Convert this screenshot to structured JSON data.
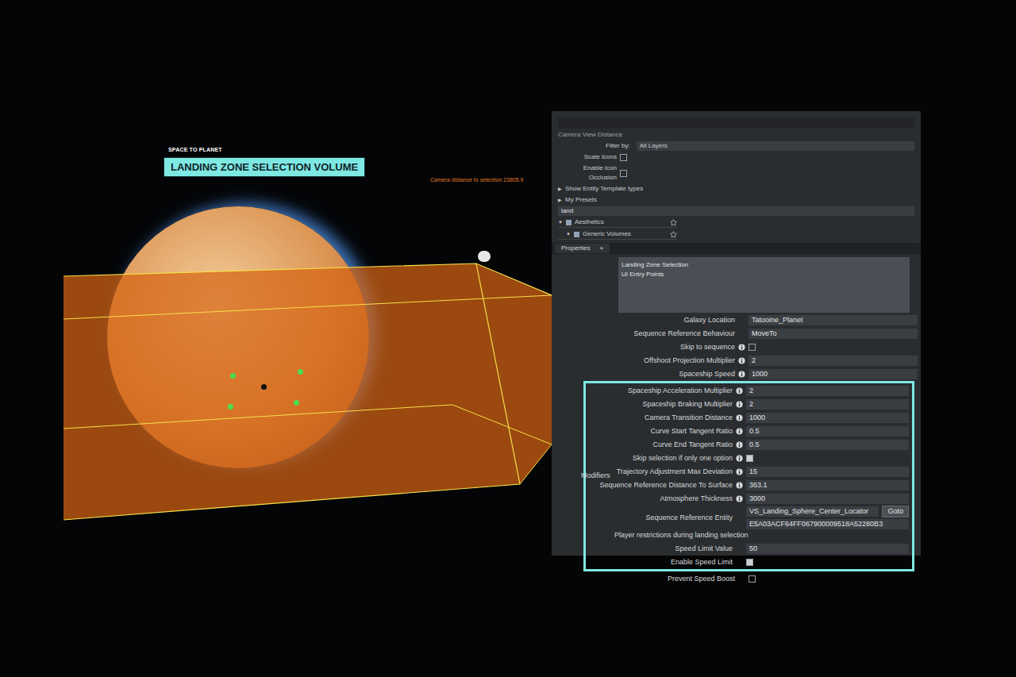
{
  "slide": {
    "section": "SPACE TO PLANET",
    "title": "LANDING ZONE SELECTION VOLUME"
  },
  "viewport": {
    "debug_lines": [
      "Camera distance to selection 23805.9"
    ],
    "markers": [
      {
        "color": "#4ade50"
      },
      {
        "color": "#4ade50"
      },
      {
        "color": "#111111"
      },
      {
        "color": "#4ade50"
      },
      {
        "color": "#4ade50"
      }
    ]
  },
  "outliner": {
    "title": "Camera View Distance",
    "filter_label": "Filter by:",
    "filter_value": "All Layers",
    "options": [
      {
        "label": "Scale Icons",
        "checked": false
      },
      {
        "label": "Enable Icon Occlusion",
        "checked": false
      }
    ],
    "expanders": [
      "Show Entity Template types",
      "My Presets"
    ],
    "search": "land",
    "tree": [
      {
        "label": "Aesthetics",
        "level": 1
      },
      {
        "label": "Generic Volumes",
        "level": 2
      }
    ]
  },
  "properties": {
    "tab": "Properties",
    "close": "×",
    "components": [
      "Landing Zone Selection",
      "UI Entry Points"
    ],
    "rows": [
      {
        "label": "Galaxy Location",
        "kind": "field",
        "value": "Tatooine_Planet",
        "info": false
      },
      {
        "label": "Sequence Reference Behaviour",
        "kind": "field",
        "value": "MoveTo",
        "info": false
      },
      {
        "label": "Skip to sequence",
        "kind": "checkbox",
        "checked": false,
        "info": true
      },
      {
        "label": "Offshoot Projection Multiplier",
        "kind": "field",
        "value": "2",
        "info": true
      },
      {
        "label": "Spaceship Speed",
        "kind": "field",
        "value": "1000",
        "info": true
      }
    ],
    "modifiers_label": "Modifiers",
    "modifier_rows": [
      {
        "label": "Spaceship Acceleration Multiplier",
        "kind": "field",
        "value": "2",
        "info": true
      },
      {
        "label": "Spaceship Braking Multiplier",
        "kind": "field",
        "value": "2",
        "info": true
      },
      {
        "label": "Camera Transition Distance",
        "kind": "field",
        "value": "1000",
        "info": true
      },
      {
        "label": "Curve Start Tangent Ratio",
        "kind": "field",
        "value": "0.5",
        "info": true
      },
      {
        "label": "Curve End Tangent Ratio",
        "kind": "field",
        "value": "0.5",
        "info": true
      },
      {
        "label": "Skip selection if only one option",
        "kind": "checkbox",
        "checked": true,
        "info": true
      },
      {
        "label": "Trajectory Adjustment Max Deviation",
        "kind": "field",
        "value": "15",
        "info": true
      },
      {
        "label": "Sequence Reference Distance To Surface",
        "kind": "field",
        "value": "363.1",
        "info": true
      },
      {
        "label": "Atmosphere Thickness",
        "kind": "field",
        "value": "3000",
        "info": true
      },
      {
        "label": "Sequence Reference Entity",
        "kind": "entity",
        "value": "VS_Landing_Sphere_Center_Locator",
        "button": "Goto",
        "id": "E5A03ACF64FF067900009518A52280B3",
        "info": false
      },
      {
        "label": "Player restrictions during landing selection",
        "kind": "header",
        "info": false
      },
      {
        "label": "Speed Limit Value",
        "kind": "field",
        "value": "50",
        "info": false
      },
      {
        "label": "Enable Speed Limit",
        "kind": "checkbox",
        "checked": true,
        "info": false
      }
    ],
    "after_rows": [
      {
        "label": "Prevent Speed Boost",
        "kind": "checkbox",
        "checked": false,
        "info": false
      }
    ]
  }
}
